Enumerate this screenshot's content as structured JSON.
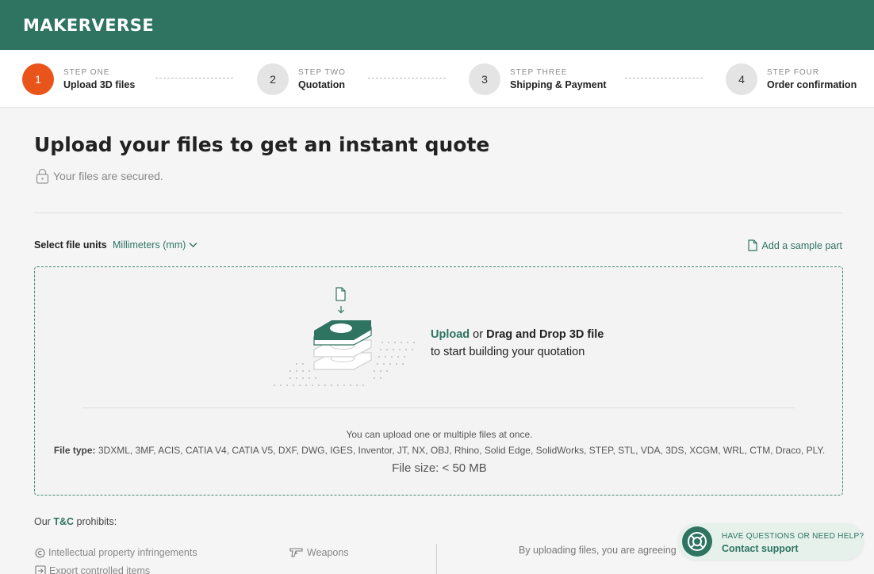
{
  "brand": "MAKERVERSE",
  "steps": [
    {
      "number": "1",
      "kicker": "STEP ONE",
      "label": "Upload 3D files"
    },
    {
      "number": "2",
      "kicker": "STEP TWO",
      "label": "Quotation"
    },
    {
      "number": "3",
      "kicker": "STEP THREE",
      "label": "Shipping & Payment"
    },
    {
      "number": "4",
      "kicker": "STEP FOUR",
      "label": "Order confirmation"
    }
  ],
  "main": {
    "title": "Upload your files to get an instant quote",
    "secured": "Your files are secured."
  },
  "units": {
    "label": "Select file units",
    "selected": "Millimeters (mm)"
  },
  "sample_part": "Add a sample part",
  "dropzone": {
    "upload_link": "Upload",
    "or": " or ",
    "drag_drop": "Drag and Drop 3D file",
    "subtitle": "to start building your quotation",
    "note": "You can upload one or multiple files at once.",
    "file_type_label": "File type:",
    "file_types": "3DXML, 3MF, ACIS, CATIA V4, CATIA V5, DXF, DWG, IGES, Inventor, JT, NX, OBJ, Rhino, Solid Edge, SolidWorks, STEP, STL, VDA, 3DS, XCGM, WRL, CTM, Draco, PLY.",
    "file_size": "File size: < 50 MB"
  },
  "terms": {
    "prefix": "Our ",
    "link": "T&C",
    "suffix": " prohibits:",
    "items": [
      "Intellectual property infringements",
      "Weapons",
      "Export controlled items"
    ],
    "agree_text": "By uploading files, you are agreeing"
  },
  "support": {
    "kicker": "HAVE QUESTIONS OR NEED HELP?",
    "label": "Contact support"
  },
  "colors": {
    "brand_green": "#2e7461",
    "active_step": "#e9541b"
  }
}
